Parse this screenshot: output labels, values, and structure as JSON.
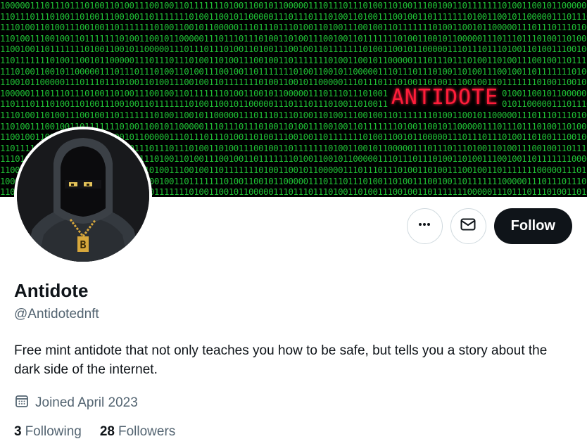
{
  "banner": {
    "title": "ANTIDOTE",
    "code_line": "10000011101110111010011010011100100110111111101001100101100000111011101110100110100111001001101111111010011001011000001110111011101001101001110010011011111110100110010110000011101110111010011010011100100110111111",
    "code_color": "#22d13a",
    "title_color": "#ff1d3a"
  },
  "profile": {
    "display_name": "Antidote",
    "handle": "@Antidotednft",
    "bio": "Free mint antidote that not only teaches you how to be safe, but tells you a story about the dark side of the internet.",
    "joined": "Joined April 2023",
    "following_count": "3",
    "following_label": "Following",
    "followers_count": "28",
    "followers_label": "Followers"
  },
  "actions": {
    "more_icon": "more-dots-icon",
    "message_icon": "envelope-icon",
    "follow_label": "Follow"
  },
  "avatar": {
    "pendant_letter": "B"
  }
}
